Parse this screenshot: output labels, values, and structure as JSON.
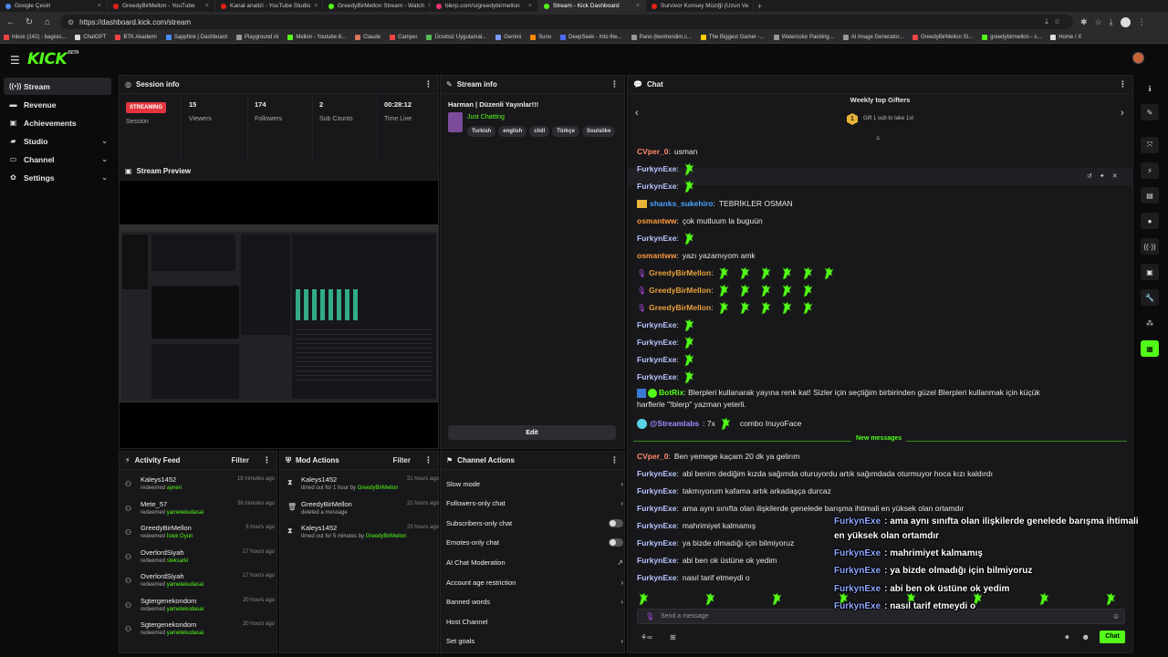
{
  "browser": {
    "tabs": [
      {
        "label": "Google Çeviri",
        "color": "#4a8af4"
      },
      {
        "label": "GreedyBirMellon - YouTube",
        "color": "#e62117"
      },
      {
        "label": "Kanal analizi - YouTube Studio",
        "color": "#e62117"
      },
      {
        "label": "GreedyBirMellon Stream - Watch",
        "color": "#53fc18"
      },
      {
        "label": "blerp.com/s/greedybirmellon",
        "color": "#e9356f"
      },
      {
        "label": "Stream - Kick Dashboard",
        "color": "#53fc18"
      },
      {
        "label": "Survivor Konsey Müziği (Uzun Ve",
        "color": "#e62117"
      }
    ],
    "url": "https://dashboard.kick.com/stream",
    "bookmarks": [
      {
        "label": "Inbox (142) - bagisis...",
        "color": "#e44"
      },
      {
        "label": "ChatGPT",
        "color": "#ddd"
      },
      {
        "label": "BTK Akademi",
        "color": "#e44"
      },
      {
        "label": "Sapphire | Dashboard",
        "color": "#4a8af4"
      },
      {
        "label": "Playground AI",
        "color": "#999"
      },
      {
        "label": "Mellon - Youtube 8...",
        "color": "#53fc18"
      },
      {
        "label": "Claude",
        "color": "#d97757"
      },
      {
        "label": "Camper",
        "color": "#e44"
      },
      {
        "label": "Ücretsiz Uygulamal...",
        "color": "#5b5"
      },
      {
        "label": "Gemini",
        "color": "#7b9cff"
      },
      {
        "label": "Suno",
        "color": "#f80"
      },
      {
        "label": "DeepSeek - Into the...",
        "color": "#4a6cf4"
      },
      {
        "label": "Pano (bentrendim.c...",
        "color": "#999"
      },
      {
        "label": "The Biggest Gamer -...",
        "color": "#fc0"
      },
      {
        "label": "Watercolor Painting...",
        "color": "#999"
      },
      {
        "label": "AI Image Generator...",
        "color": "#999"
      },
      {
        "label": "GreedyBirMellon St...",
        "color": "#e44"
      },
      {
        "label": "greedybirmellon - s...",
        "color": "#53fc18"
      },
      {
        "label": "Home / X",
        "color": "#ddd"
      }
    ]
  },
  "app": {
    "logo": "KICK",
    "logo_sup": "BETA"
  },
  "sidebar": {
    "items": [
      {
        "label": "Stream",
        "icon": "broadcast-icon"
      },
      {
        "label": "Revenue",
        "icon": "revenue-icon"
      },
      {
        "label": "Achievements",
        "icon": "trophy-icon"
      },
      {
        "label": "Studio",
        "icon": "studio-icon"
      },
      {
        "label": "Channel",
        "icon": "channel-icon"
      },
      {
        "label": "Settings",
        "icon": "gear-icon"
      }
    ]
  },
  "session": {
    "title": "Session info",
    "status": "STREAMING",
    "status_label": "Session",
    "viewers": "15",
    "viewers_label": "Viewers",
    "followers": "174",
    "followers_label": "Followers",
    "subs": "2",
    "subs_label": "Sub Counts",
    "time": "00:28:12",
    "time_label": "Time Live"
  },
  "preview": {
    "title": "Stream Preview"
  },
  "stream_info": {
    "title": "Stream info",
    "stream_title": "Harman | Düzenli Yayınlar!!!",
    "category": "Just Chatting",
    "tags": [
      "Turkish",
      "english",
      "chill",
      "Türkçe",
      "Soulslike"
    ],
    "edit_label": "Edit"
  },
  "activity": {
    "title": "Activity Feed",
    "filter": "Filter",
    "items": [
      {
        "name": "Kaleys1452",
        "action": "redeemed",
        "reward": "aynen",
        "time": "18 minutes ago"
      },
      {
        "name": "Mete_57",
        "action": "redeemed",
        "reward": "yametekudasai",
        "time": "38 minutes ago"
      },
      {
        "name": "GreedyBirMellon",
        "action": "redeemed",
        "reward": "İstek Oyun",
        "time": "3 hours ago"
      },
      {
        "name": "OverlordSiyah",
        "action": "redeemed",
        "reward": "steksarki",
        "time": "17 hours ago"
      },
      {
        "name": "OverlordSiyah",
        "action": "redeemed",
        "reward": "yametekudasai",
        "time": "17 hours ago"
      },
      {
        "name": "Sgtergenekondom",
        "action": "redeemed",
        "reward": "yametekudasai",
        "time": "20 hours ago"
      },
      {
        "name": "Sgtergenekondom",
        "action": "redeemed",
        "reward": "yametekudasai",
        "time": "20 hours ago"
      }
    ]
  },
  "mod": {
    "title": "Mod Actions",
    "filter": "Filter",
    "items": [
      {
        "name": "Kaleys1452",
        "desc": "timed out for 1 hour by",
        "by": "GreedyBirMellon",
        "time": "21 hours ago",
        "icon": "hourglass-icon"
      },
      {
        "name": "GreedyBirMellon",
        "desc": "deleted a message",
        "by": "",
        "time": "21 hours ago",
        "icon": "trash-icon"
      },
      {
        "name": "Kaleys1452",
        "desc": "timed out for 5 minutes by",
        "by": "GreedyBirMellon",
        "time": "23 hours ago",
        "icon": "hourglass-icon"
      }
    ]
  },
  "channel_actions": {
    "title": "Channel Actions",
    "items": [
      {
        "label": "Slow mode",
        "control": "chevron"
      },
      {
        "label": "Followers-only chat",
        "control": "chevron"
      },
      {
        "label": "Subscribers-only chat",
        "control": "toggle"
      },
      {
        "label": "Emotes-only chat",
        "control": "toggle"
      },
      {
        "label": "AI Chat Moderation",
        "control": "chart"
      },
      {
        "label": "Account age restriction",
        "control": "chevron"
      },
      {
        "label": "Banned words",
        "control": "chevron"
      },
      {
        "label": "Host Channel",
        "control": "none"
      },
      {
        "label": "Set goals",
        "control": "chevron"
      }
    ]
  },
  "chat": {
    "title": "Chat",
    "gifters_title": "Weekly top Gifters",
    "gifters_sub": "Gift 1 sub to take 1st",
    "gifters_rank": "1",
    "new_messages": "New messages",
    "input_placeholder": "Send a message",
    "send_label": "Chat",
    "messages": [
      {
        "user": "CVper_0",
        "color": "#ff8c6b",
        "text": "usman",
        "emotes": 0
      },
      {
        "user": "FurkynExe",
        "color": "#b8c4ff",
        "text": "",
        "emotes": 1
      },
      {
        "user": "FurkynExe",
        "color": "#b8c4ff",
        "text": "",
        "emotes": 1
      },
      {
        "user": "shanks_sukehiro",
        "color": "#4aa3ff",
        "text": "TEBRİKLER OSMAN",
        "emotes": 0,
        "badge": true
      },
      {
        "user": "osmantww",
        "color": "#ff9a3c",
        "text": "çok mutluum la buguün",
        "emotes": 0
      },
      {
        "user": "FurkynExe",
        "color": "#b8c4ff",
        "text": "",
        "emotes": 1
      },
      {
        "user": "osmantww",
        "color": "#ff9a3c",
        "text": "yazı yazamıyom amk",
        "emotes": 0
      },
      {
        "user": "GreedyBirMellon",
        "color": "#e9a23b",
        "text": "",
        "emotes": 6,
        "mic": true
      },
      {
        "user": "GreedyBirMellon",
        "color": "#e9a23b",
        "text": "",
        "emotes": 5,
        "mic": true
      },
      {
        "user": "GreedyBirMellon",
        "color": "#e9a23b",
        "text": "",
        "emotes": 5,
        "mic": true
      },
      {
        "user": "FurkynExe",
        "color": "#b8c4ff",
        "text": "",
        "emotes": 1
      },
      {
        "user": "FurkynExe",
        "color": "#b8c4ff",
        "text": "",
        "emotes": 1
      },
      {
        "user": "FurkynExe",
        "color": "#b8c4ff",
        "text": "",
        "emotes": 1
      },
      {
        "user": "FurkynExe",
        "color": "#b8c4ff",
        "text": "",
        "emotes": 1
      }
    ],
    "botrix_user": "BotRix",
    "botrix_text_1": "Blerpleri kullanarak yayına renk kat! Sizler için seçtiğim birbirinden güzel Blerpleri kullanmak için küçük",
    "botrix_text_2": "harflerle \"!blerp\" yazman yeterli.",
    "streamlabs_user": "@Streamlabs",
    "streamlabs_count": ": 7x",
    "streamlabs_text": "combo InuyoFace",
    "new_list": [
      {
        "user": "CVper_0",
        "color": "#ff8c6b",
        "text": "Ben yemege kaçam 20 dk ya gelirım"
      },
      {
        "user": "FurkynExe",
        "color": "#b8c4ff",
        "text": "abi benim dediğim kızda sağımda oturuyordu artık sağımdada oturmuyor hoca kızı kaldırdı"
      },
      {
        "user": "FurkynExe",
        "color": "#b8c4ff",
        "text": "takmıyorum kafama artık arkadaşça durcaz"
      },
      {
        "user": "FurkynExe",
        "color": "#b8c4ff",
        "text": "ama aynı sınıfta olan ilişkilerde genelede barışma ihtimali en yüksek olan ortamdır"
      },
      {
        "user": "FurkynExe",
        "color": "#b8c4ff",
        "text": "mahrimiyet kalmamış"
      },
      {
        "user": "FurkynExe",
        "color": "#b8c4ff",
        "text": "ya bizde olmadığı için bilmiyoruz"
      },
      {
        "user": "FurkynExe",
        "color": "#b8c4ff",
        "text": "abi ben ok üstüne ok yedim"
      },
      {
        "user": "FurkynExe",
        "color": "#b8c4ff",
        "text": "nasıl tarif etmeydi o"
      }
    ]
  },
  "overlay": {
    "lines": [
      {
        "user": "FurkynExe",
        "text": ": ama aynı sınıfta olan ilişkilerde genelede barışma ihtimali"
      },
      {
        "user": "",
        "text": "en yüksek olan ortamdır"
      },
      {
        "user": "FurkynExe",
        "text": ": mahrimiyet kalmamış"
      },
      {
        "user": "FurkynExe",
        "text": ": ya bizde olmadığı için bilmiyoruz"
      },
      {
        "user": "FurkynExe",
        "text": ": abi ben ok üstüne ok yedim"
      },
      {
        "user": "FurkynExe",
        "text": ": nasıl tarif etmeydi o"
      }
    ]
  }
}
